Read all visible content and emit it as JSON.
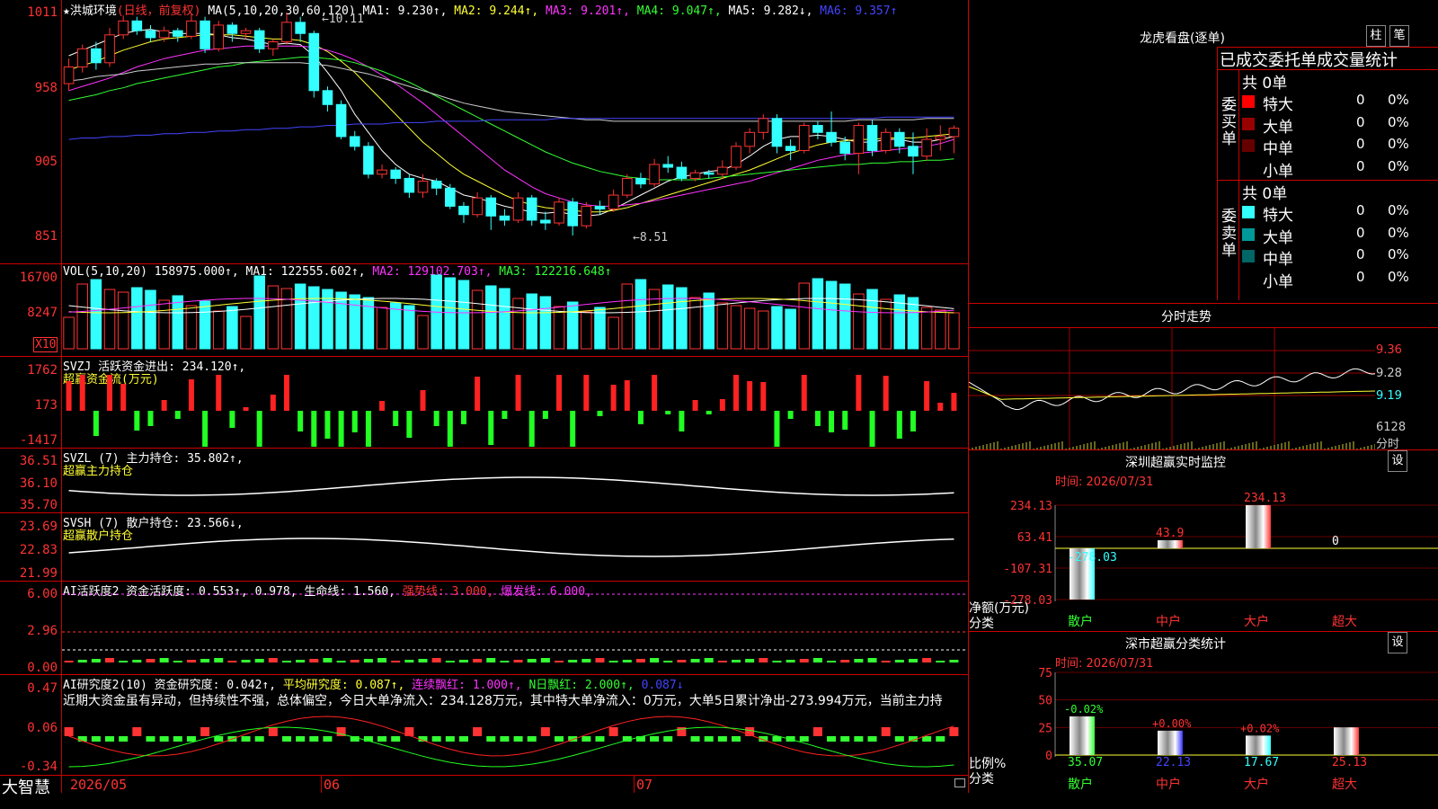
{
  "main_chart": {
    "star": "★",
    "stock_name": "洪城环境",
    "mode": "(日线，前复权)",
    "ma_title": "MA(5,10,20,30,60,120)",
    "ma1": "MA1: 9.230↑,",
    "ma2": "MA2: 9.244↑,",
    "ma3": "MA3: 9.201↑,",
    "ma4": "MA4: 9.047↑,",
    "ma5": "MA5: 9.282↓,",
    "ma6": "MA6: 9.357↑",
    "high_mark": "10.11",
    "low_mark": "←8.51",
    "y_ticks": [
      "1011",
      "958",
      "905",
      "851"
    ],
    "candles": [
      {
        "o": 9.6,
        "c": 9.72,
        "h": 9.78,
        "l": 9.55
      },
      {
        "o": 9.72,
        "c": 9.85,
        "h": 9.88,
        "l": 9.68
      },
      {
        "o": 9.85,
        "c": 9.75,
        "h": 9.9,
        "l": 9.7
      },
      {
        "o": 9.75,
        "c": 9.95,
        "h": 10.0,
        "l": 9.72
      },
      {
        "o": 9.95,
        "c": 10.05,
        "h": 10.09,
        "l": 9.92
      },
      {
        "o": 10.05,
        "c": 9.98,
        "h": 10.08,
        "l": 9.95
      },
      {
        "o": 9.98,
        "c": 9.93,
        "h": 10.02,
        "l": 9.9
      },
      {
        "o": 9.93,
        "c": 9.98,
        "h": 10.01,
        "l": 9.9
      },
      {
        "o": 9.98,
        "c": 9.94,
        "h": 10.0,
        "l": 9.9
      },
      {
        "o": 9.94,
        "c": 10.05,
        "h": 10.1,
        "l": 9.92
      },
      {
        "o": 10.05,
        "c": 9.85,
        "h": 10.08,
        "l": 9.82
      },
      {
        "o": 9.85,
        "c": 10.02,
        "h": 10.05,
        "l": 9.83
      },
      {
        "o": 10.02,
        "c": 9.96,
        "h": 10.04,
        "l": 9.9
      },
      {
        "o": 9.96,
        "c": 9.98,
        "h": 10.0,
        "l": 9.92
      },
      {
        "o": 9.98,
        "c": 9.85,
        "h": 10.0,
        "l": 9.82
      },
      {
        "o": 9.85,
        "c": 9.9,
        "h": 9.92,
        "l": 9.8
      },
      {
        "o": 9.9,
        "c": 10.04,
        "h": 10.11,
        "l": 9.88
      },
      {
        "o": 10.04,
        "c": 9.96,
        "h": 10.08,
        "l": 9.9
      },
      {
        "o": 9.96,
        "c": 9.55,
        "h": 9.98,
        "l": 9.5
      },
      {
        "o": 9.55,
        "c": 9.45,
        "h": 9.58,
        "l": 9.4
      },
      {
        "o": 9.45,
        "c": 9.22,
        "h": 9.48,
        "l": 9.2
      },
      {
        "o": 9.22,
        "c": 9.15,
        "h": 9.26,
        "l": 9.12
      },
      {
        "o": 9.15,
        "c": 8.95,
        "h": 9.18,
        "l": 8.92
      },
      {
        "o": 8.95,
        "c": 8.98,
        "h": 9.02,
        "l": 8.92
      },
      {
        "o": 8.98,
        "c": 8.92,
        "h": 9.0,
        "l": 8.88
      },
      {
        "o": 8.92,
        "c": 8.82,
        "h": 8.95,
        "l": 8.78
      },
      {
        "o": 8.82,
        "c": 8.9,
        "h": 8.95,
        "l": 8.78
      },
      {
        "o": 8.9,
        "c": 8.85,
        "h": 8.92,
        "l": 8.8
      },
      {
        "o": 8.85,
        "c": 8.72,
        "h": 8.88,
        "l": 8.7
      },
      {
        "o": 8.72,
        "c": 8.66,
        "h": 8.75,
        "l": 8.6
      },
      {
        "o": 8.66,
        "c": 8.78,
        "h": 8.82,
        "l": 8.64
      },
      {
        "o": 8.78,
        "c": 8.65,
        "h": 8.8,
        "l": 8.55
      },
      {
        "o": 8.65,
        "c": 8.62,
        "h": 8.7,
        "l": 8.58
      },
      {
        "o": 8.62,
        "c": 8.78,
        "h": 8.82,
        "l": 8.6
      },
      {
        "o": 8.78,
        "c": 8.62,
        "h": 8.8,
        "l": 8.58
      },
      {
        "o": 8.62,
        "c": 8.6,
        "h": 8.68,
        "l": 8.55
      },
      {
        "o": 8.6,
        "c": 8.75,
        "h": 8.78,
        "l": 8.58
      },
      {
        "o": 8.75,
        "c": 8.58,
        "h": 8.78,
        "l": 8.51
      },
      {
        "o": 8.58,
        "c": 8.72,
        "h": 8.75,
        "l": 8.56
      },
      {
        "o": 8.72,
        "c": 8.7,
        "h": 8.76,
        "l": 8.66
      },
      {
        "o": 8.7,
        "c": 8.8,
        "h": 8.84,
        "l": 8.68
      },
      {
        "o": 8.8,
        "c": 8.92,
        "h": 8.95,
        "l": 8.78
      },
      {
        "o": 8.92,
        "c": 8.88,
        "h": 8.96,
        "l": 8.85
      },
      {
        "o": 8.88,
        "c": 9.02,
        "h": 9.06,
        "l": 8.86
      },
      {
        "o": 9.02,
        "c": 9.0,
        "h": 9.08,
        "l": 8.96
      },
      {
        "o": 9.0,
        "c": 8.92,
        "h": 9.04,
        "l": 8.9
      },
      {
        "o": 8.92,
        "c": 8.96,
        "h": 8.98,
        "l": 8.9
      },
      {
        "o": 8.96,
        "c": 8.95,
        "h": 8.98,
        "l": 8.92
      },
      {
        "o": 8.95,
        "c": 9.0,
        "h": 9.05,
        "l": 8.92
      },
      {
        "o": 9.0,
        "c": 9.15,
        "h": 9.18,
        "l": 8.98
      },
      {
        "o": 9.15,
        "c": 9.25,
        "h": 9.28,
        "l": 9.1
      },
      {
        "o": 9.25,
        "c": 9.35,
        "h": 9.38,
        "l": 9.2
      },
      {
        "o": 9.35,
        "c": 9.15,
        "h": 9.38,
        "l": 9.1
      },
      {
        "o": 9.15,
        "c": 9.12,
        "h": 9.2,
        "l": 9.05
      },
      {
        "o": 9.12,
        "c": 9.3,
        "h": 9.32,
        "l": 9.1
      },
      {
        "o": 9.3,
        "c": 9.25,
        "h": 9.33,
        "l": 9.2
      },
      {
        "o": 9.25,
        "c": 9.18,
        "h": 9.4,
        "l": 9.15
      },
      {
        "o": 9.18,
        "c": 9.1,
        "h": 9.22,
        "l": 9.05
      },
      {
        "o": 9.1,
        "c": 9.3,
        "h": 9.32,
        "l": 8.95
      },
      {
        "o": 9.3,
        "c": 9.12,
        "h": 9.34,
        "l": 9.08
      },
      {
        "o": 9.12,
        "c": 9.25,
        "h": 9.28,
        "l": 9.1
      },
      {
        "o": 9.25,
        "c": 9.15,
        "h": 9.28,
        "l": 9.1
      },
      {
        "o": 9.15,
        "c": 9.08,
        "h": 9.25,
        "l": 8.95
      },
      {
        "o": 9.08,
        "c": 9.2,
        "h": 9.28,
        "l": 9.05
      },
      {
        "o": 9.2,
        "c": 9.22,
        "h": 9.3,
        "l": 9.12
      },
      {
        "o": 9.22,
        "c": 9.28,
        "h": 9.3,
        "l": 9.1
      }
    ],
    "ma_lines": [
      {
        "name": "MA1",
        "color": "#ffffff",
        "values": [
          9.8,
          9.84,
          9.88,
          9.92,
          9.96,
          9.98,
          9.99,
          9.97,
          9.96,
          9.96,
          9.96,
          9.95,
          9.93,
          9.92,
          9.9,
          9.88,
          9.89,
          9.88,
          9.8,
          9.68,
          9.55,
          9.38,
          9.25,
          9.12,
          9.02,
          8.95,
          8.92,
          8.9,
          8.85,
          8.8,
          8.78,
          8.75,
          8.72,
          8.7,
          8.68,
          8.67,
          8.68,
          8.66,
          8.65,
          8.66,
          8.7,
          8.75,
          8.8,
          8.85,
          8.9,
          8.93,
          8.95,
          8.97,
          8.98,
          9.02,
          9.08,
          9.15,
          9.2,
          9.22,
          9.22,
          9.23,
          9.22,
          9.2,
          9.18,
          9.18,
          9.2,
          9.2,
          9.18,
          9.18,
          9.2,
          9.22
        ]
      },
      {
        "name": "MA2",
        "color": "#ffff33",
        "values": [
          9.7,
          9.73,
          9.76,
          9.8,
          9.84,
          9.87,
          9.9,
          9.92,
          9.93,
          9.94,
          9.95,
          9.95,
          9.95,
          9.94,
          9.93,
          9.92,
          9.92,
          9.91,
          9.88,
          9.83,
          9.76,
          9.68,
          9.58,
          9.48,
          9.38,
          9.28,
          9.18,
          9.1,
          9.02,
          8.95,
          8.9,
          8.85,
          8.8,
          8.76,
          8.73,
          8.71,
          8.7,
          8.69,
          8.68,
          8.68,
          8.69,
          8.71,
          8.74,
          8.77,
          8.8,
          8.83,
          8.86,
          8.89,
          8.92,
          8.95,
          8.98,
          9.02,
          9.06,
          9.1,
          9.13,
          9.16,
          9.18,
          9.19,
          9.2,
          9.2,
          9.21,
          9.21,
          9.21,
          9.22,
          9.23,
          9.24
        ]
      },
      {
        "name": "MA3",
        "color": "#ff33ff",
        "values": [
          9.55,
          9.58,
          9.61,
          9.64,
          9.68,
          9.72,
          9.75,
          9.78,
          9.8,
          9.82,
          9.84,
          9.85,
          9.86,
          9.87,
          9.87,
          9.87,
          9.87,
          9.87,
          9.86,
          9.84,
          9.81,
          9.77,
          9.72,
          9.66,
          9.6,
          9.53,
          9.46,
          9.38,
          9.3,
          9.22,
          9.14,
          9.06,
          8.98,
          8.92,
          8.86,
          8.81,
          8.78,
          8.75,
          8.73,
          8.72,
          8.72,
          8.73,
          8.74,
          8.76,
          8.78,
          8.8,
          8.82,
          8.84,
          8.86,
          8.88,
          8.9,
          8.93,
          8.96,
          8.99,
          9.02,
          9.05,
          9.07,
          9.09,
          9.1,
          9.11,
          9.12,
          9.13,
          9.14,
          9.15,
          9.17,
          9.2
        ]
      },
      {
        "name": "MA4",
        "color": "#33ff33",
        "values": [
          9.48,
          9.5,
          9.52,
          9.55,
          9.57,
          9.6,
          9.62,
          9.64,
          9.66,
          9.68,
          9.7,
          9.72,
          9.73,
          9.75,
          9.76,
          9.77,
          9.78,
          9.79,
          9.79,
          9.78,
          9.77,
          9.75,
          9.72,
          9.69,
          9.65,
          9.61,
          9.56,
          9.51,
          9.46,
          9.41,
          9.36,
          9.31,
          9.26,
          9.21,
          9.16,
          9.11,
          9.07,
          9.03,
          9.0,
          8.97,
          8.95,
          8.93,
          8.92,
          8.91,
          8.91,
          8.91,
          8.91,
          8.92,
          8.93,
          8.94,
          8.95,
          8.96,
          8.97,
          8.98,
          8.99,
          9.0,
          9.01,
          9.02,
          9.02,
          9.03,
          9.03,
          9.04,
          9.04,
          9.05,
          9.05,
          9.06
        ]
      },
      {
        "name": "MA5",
        "color": "#cccccc",
        "values": [
          9.62,
          9.63,
          9.65,
          9.66,
          9.67,
          9.69,
          9.7,
          9.71,
          9.72,
          9.73,
          9.74,
          9.74,
          9.75,
          9.75,
          9.75,
          9.75,
          9.75,
          9.75,
          9.74,
          9.73,
          9.71,
          9.69,
          9.67,
          9.64,
          9.61,
          9.58,
          9.55,
          9.52,
          9.49,
          9.46,
          9.44,
          9.42,
          9.4,
          9.39,
          9.38,
          9.37,
          9.36,
          9.35,
          9.34,
          9.34,
          9.33,
          9.33,
          9.33,
          9.33,
          9.33,
          9.33,
          9.33,
          9.33,
          9.33,
          9.33,
          9.33,
          9.33,
          9.33,
          9.33,
          9.33,
          9.33,
          9.33,
          9.33,
          9.34,
          9.34,
          9.34,
          9.34,
          9.34,
          9.35,
          9.35,
          9.35
        ]
      },
      {
        "name": "MA6",
        "color": "#4444ff",
        "values": [
          9.2,
          9.21,
          9.21,
          9.22,
          9.22,
          9.23,
          9.23,
          9.24,
          9.24,
          9.25,
          9.25,
          9.26,
          9.26,
          9.27,
          9.27,
          9.28,
          9.28,
          9.29,
          9.29,
          9.3,
          9.3,
          9.31,
          9.31,
          9.31,
          9.32,
          9.32,
          9.32,
          9.33,
          9.33,
          9.33,
          9.33,
          9.34,
          9.34,
          9.34,
          9.34,
          9.34,
          9.35,
          9.35,
          9.35,
          9.35,
          9.35,
          9.35,
          9.35,
          9.35,
          9.35,
          9.35,
          9.35,
          9.35,
          9.35,
          9.35,
          9.35,
          9.35,
          9.35,
          9.35,
          9.35,
          9.35,
          9.35,
          9.35,
          9.35,
          9.35,
          9.36,
          9.36,
          9.36,
          9.36,
          9.36,
          9.36
        ]
      }
    ]
  },
  "vol": {
    "title": "VOL(5,10,20)",
    "value": "158975.000↑,",
    "ma1": "MA1: 122555.602↑,",
    "ma2": "MA2: 129102.703↑,",
    "ma3": "MA3: 122216.648↑",
    "y_ticks": [
      "16700",
      "8247"
    ],
    "unit": "X10"
  },
  "svzj": {
    "title": "SVZJ  活跃资金进出: 234.120↑,",
    "subtitle": "超赢资金流(万元)",
    "y_ticks": [
      "1762",
      "173",
      "-1417"
    ]
  },
  "svzl": {
    "title": "SVZL (7) 主力持仓: 35.802↑,",
    "subtitle": "超赢主力持仓",
    "y_ticks": [
      "36.51",
      "36.10",
      "35.70"
    ]
  },
  "svsh": {
    "title": "SVSH (7) 散户持仓: 23.566↓,",
    "subtitle": "超赢散户持仓",
    "y_ticks": [
      "23.69",
      "22.83",
      "21.99"
    ]
  },
  "ai_active": {
    "title": "AI活跃度2 资金活跃度: 0.553↑,",
    "v2": "0.978,",
    "life": "生命线: 1.560,",
    "strong": "强势线: 3.000,",
    "burst": "爆发线: 6.000,",
    "y_ticks": [
      "6.00",
      "2.96",
      "0.00"
    ]
  },
  "ai_research": {
    "title": "AI研究度2(10) 资金研究度: 0.042↑,",
    "avg": "平均研究度: 0.087↑,",
    "cont": "连续飘红: 1.000↑,",
    "nday": "N日飘红: 2.000↑,",
    "last": "0.087↓",
    "commentary": "近期大资金虽有异动，但持续性不强，总体偏空，今日大单净流入：234.128万元，其中特大单净流入：0万元，大单5日累计净出-273.994万元，当前主力持",
    "y_ticks": [
      "0.47",
      "0.06",
      "-0.34"
    ]
  },
  "bottom_bar": {
    "brand": "大智慧",
    "dates": [
      "2026/05",
      "06",
      "07"
    ]
  },
  "right_panel": {
    "dragon_title": "龙虎看盘(逐单)",
    "btn_bar": "柱",
    "btn_pen": "笔",
    "stat_header": "已成交委托单成交量统计",
    "buy_label": "委买单",
    "sell_label": "委卖单",
    "buy_total": "共 0单",
    "sell_total": "共 0单",
    "buy_rows": [
      {
        "name": "特大",
        "count": "0",
        "pct": "0%",
        "color": "#ff0000"
      },
      {
        "name": "大单",
        "count": "0",
        "pct": "0%",
        "color": "#990000"
      },
      {
        "name": "中单",
        "count": "0",
        "pct": "0%",
        "color": "#660000"
      },
      {
        "name": "小单",
        "count": "0",
        "pct": "0%",
        "color": "#000000"
      }
    ],
    "sell_rows": [
      {
        "name": "特大",
        "count": "0",
        "pct": "0%",
        "color": "#33ffff"
      },
      {
        "name": "大单",
        "count": "0",
        "pct": "0%",
        "color": "#009999"
      },
      {
        "name": "中单",
        "count": "0",
        "pct": "0%",
        "color": "#006666"
      },
      {
        "name": "小单",
        "count": "0",
        "pct": "0%",
        "color": "#000000"
      }
    ],
    "timeshare_title": "分时走势",
    "ts_ticks": [
      "9.36",
      "9.28",
      "9.19"
    ],
    "ts_vol": "6128",
    "ts_vol_unit": "分时",
    "sz_title": "深圳超赢实时监控",
    "sz_set": "设",
    "sz_time": "时间: 2026/07/31",
    "sz_ticks": [
      "234.13",
      "63.41",
      "-107.31",
      "-278.03"
    ],
    "sz_ylabel": "净额(万元)",
    "sz_xlabel": "分类",
    "sz_cats": [
      "散户",
      "中户",
      "大户",
      "超大"
    ],
    "sz_values": [
      "-278.03",
      "43.9",
      "234.13",
      "0"
    ],
    "cls_title": "深市超赢分类统计",
    "cls_set": "设",
    "cls_time": "时间: 2026/07/31",
    "cls_ticks": [
      "75",
      "50",
      "25",
      "0"
    ],
    "cls_ylabel": "比例%",
    "cls_xlabel": "分类",
    "cls_cats": [
      "散户",
      "中户",
      "大户",
      "超大"
    ],
    "cls_values": [
      "35.07",
      "22.13",
      "17.67",
      "25.13"
    ],
    "cls_changes": [
      "-0.02%",
      "+0.00%",
      "+0.02%",
      ""
    ]
  },
  "chart_data": [
    {
      "type": "bar",
      "title": "深圳超赢实时监控",
      "ylabel": "净额(万元)",
      "xlabel": "分类",
      "categories": [
        "散户",
        "中户",
        "大户",
        "超大"
      ],
      "values": [
        -278.03,
        43.9,
        234.13,
        0
      ],
      "ylim": [
        -278.03,
        234.13
      ]
    },
    {
      "type": "bar",
      "title": "深市超赢分类统计",
      "ylabel": "比例%",
      "xlabel": "分类",
      "categories": [
        "散户",
        "中户",
        "大户",
        "超大"
      ],
      "values": [
        35.07,
        22.13,
        17.67,
        25.13
      ],
      "ylim": [
        0,
        75
      ]
    }
  ]
}
